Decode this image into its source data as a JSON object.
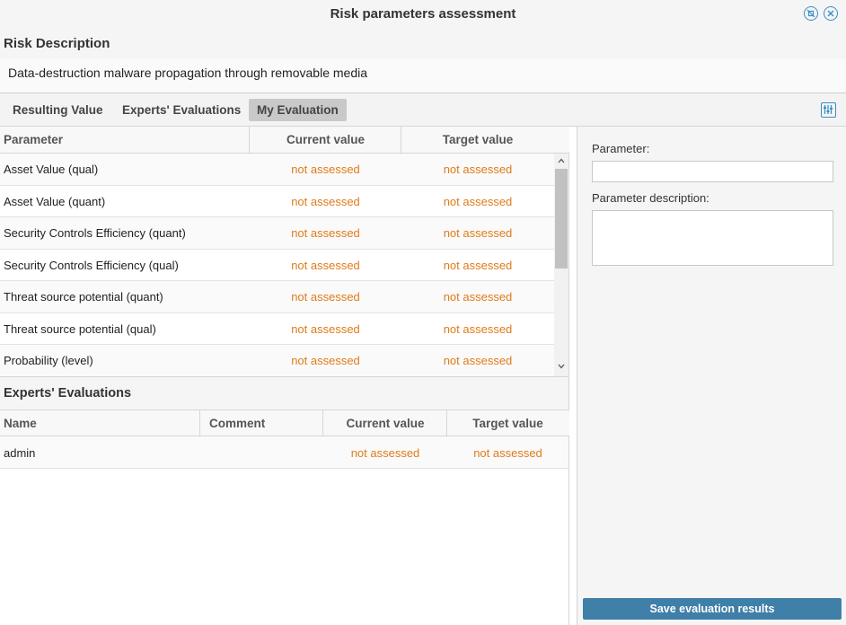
{
  "window": {
    "title": "Risk parameters assessment"
  },
  "risk": {
    "heading": "Risk Description",
    "description": "Data-destruction malware propagation through removable media"
  },
  "tabs": [
    {
      "label": "Resulting Value"
    },
    {
      "label": "Experts' Evaluations"
    },
    {
      "label": "My Evaluation",
      "active": true
    }
  ],
  "parameters_table": {
    "columns": [
      "Parameter",
      "Current value",
      "Target value"
    ],
    "rows": [
      {
        "name": "Asset Value (qual)",
        "current": "not assessed",
        "target": "not assessed"
      },
      {
        "name": "Asset Value (quant)",
        "current": "not assessed",
        "target": "not assessed"
      },
      {
        "name": "Security Controls Efficiency (quant)",
        "current": "not assessed",
        "target": "not assessed"
      },
      {
        "name": "Security Controls Efficiency (qual)",
        "current": "not assessed",
        "target": "not assessed"
      },
      {
        "name": "Threat source potential (quant)",
        "current": "not assessed",
        "target": "not assessed"
      },
      {
        "name": "Threat source potential (qual)",
        "current": "not assessed",
        "target": "not assessed"
      },
      {
        "name": "Probability (level)",
        "current": "not assessed",
        "target": "not assessed"
      }
    ]
  },
  "experts": {
    "heading": "Experts' Evaluations",
    "columns": [
      "Name",
      "Comment",
      "Current value",
      "Target value"
    ],
    "rows": [
      {
        "name": "admin",
        "comment": "",
        "current": "not assessed",
        "target": "not assessed"
      }
    ]
  },
  "side_panel": {
    "parameter_label": "Parameter:",
    "parameter_value": "",
    "description_label": "Parameter description:",
    "description_value": "",
    "save_label": "Save evaluation results"
  },
  "colors": {
    "accent": "#3f7fa8",
    "not_assessed": "#e07b1a"
  },
  "icons": [
    "restore-icon",
    "close-icon",
    "column-settings-icon",
    "scroll-up-icon",
    "scroll-down-icon"
  ]
}
